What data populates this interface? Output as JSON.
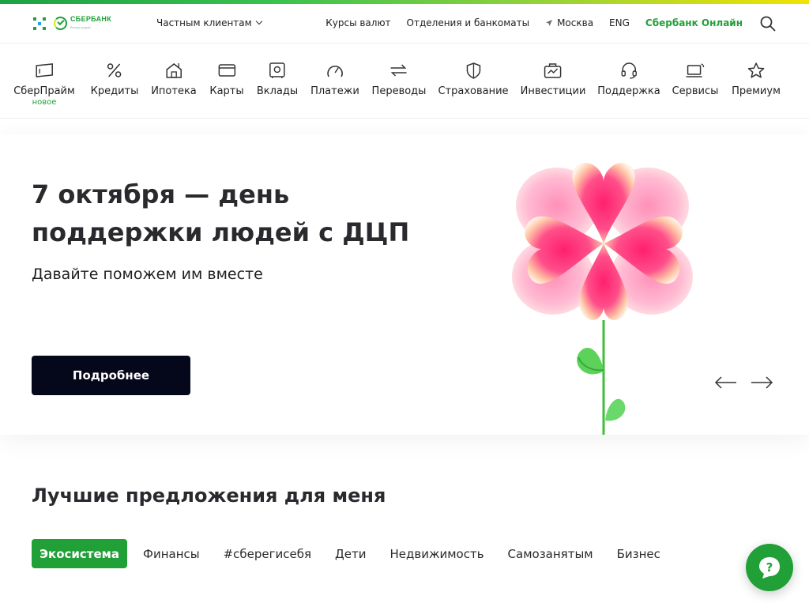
{
  "header": {
    "logo_text": "СБЕРБАНК",
    "logo_subtext": "Всегда рядом",
    "segment_label": "Частным клиентам",
    "links": [
      {
        "id": "rates",
        "label": "Курсы валют"
      },
      {
        "id": "offices",
        "label": "Отделения и банкоматы"
      },
      {
        "id": "city",
        "label": "Москва",
        "icon": "location-arrow-icon"
      },
      {
        "id": "lang",
        "label": "ENG"
      },
      {
        "id": "online",
        "label": "Сбербанк Онлайн",
        "color": "#21a038"
      }
    ],
    "search_icon": "search-icon"
  },
  "categories": [
    {
      "label": "СберПрайм",
      "badge": "новое",
      "icon": "ticket-icon"
    },
    {
      "label": "Кредиты",
      "icon": "percent-icon"
    },
    {
      "label": "Ипотека",
      "icon": "house-icon"
    },
    {
      "label": "Карты",
      "icon": "card-icon"
    },
    {
      "label": "Вклады",
      "icon": "safe-icon"
    },
    {
      "label": "Платежи",
      "icon": "speedometer-icon"
    },
    {
      "label": "Переводы",
      "icon": "transfer-arrows-icon"
    },
    {
      "label": "Страхование",
      "icon": "shield-icon"
    },
    {
      "label": "Инвестиции",
      "icon": "briefcase-chart-icon"
    },
    {
      "label": "Поддержка",
      "icon": "headset-icon"
    },
    {
      "label": "Сервисы",
      "icon": "laptop-icon"
    },
    {
      "label": "Премиум",
      "icon": "star-icon"
    }
  ],
  "hero": {
    "title": "7 октября — день поддержки людей с ДЦП",
    "subtitle": "Давайте поможем им вместе",
    "button_label": "Подробнее",
    "prev_icon": "arrow-left-icon",
    "next_icon": "arrow-right-icon"
  },
  "offers": {
    "title": "Лучшие предложения для меня",
    "tabs": [
      {
        "label": "Экосистема",
        "active": true
      },
      {
        "label": "Финансы"
      },
      {
        "label": "#сберегисебя"
      },
      {
        "label": "Дети"
      },
      {
        "label": "Недвижимость"
      },
      {
        "label": "Самозанятым"
      },
      {
        "label": "Бизнес"
      }
    ]
  },
  "chat_icon": "chat-question-icon",
  "colors": {
    "brand_green": "#21a038",
    "button_dark": "#05071a",
    "text": "#1f1f22"
  }
}
